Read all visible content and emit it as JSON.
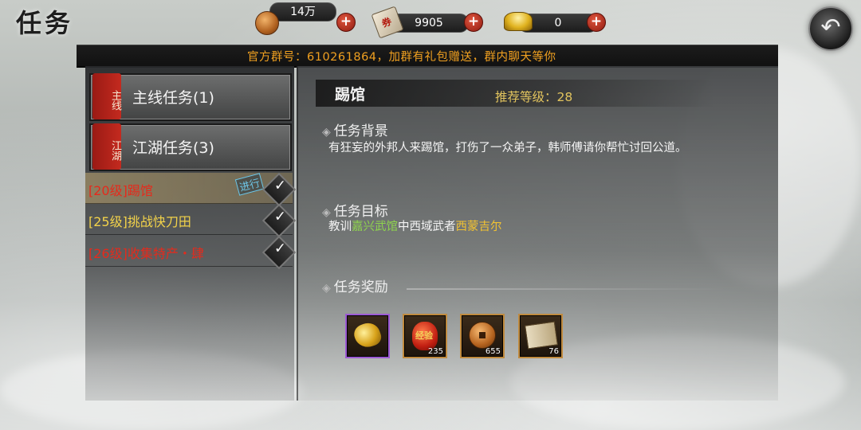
{
  "header": {
    "title": "任务"
  },
  "resources": [
    {
      "icon": "copper-coin-icon",
      "value": "14万"
    },
    {
      "icon": "scroll-ticket-icon",
      "value": "9905"
    },
    {
      "icon": "gold-ingot-icon",
      "value": "0"
    }
  ],
  "notice": {
    "text": "官方群号：610261864，加群有礼包赠送，群内聊天等你"
  },
  "categories": [
    {
      "seal": "主线",
      "label": "主线任务(1)"
    },
    {
      "seal": "江湖",
      "label": "江湖任务(3)"
    }
  ],
  "quests": [
    {
      "text": "[20级]踢馆",
      "color": "#e52a1c",
      "status": "进行",
      "active": true
    },
    {
      "text": "[25级]挑战快刀田",
      "color": "#f2d24a",
      "active": false
    },
    {
      "text": "[26级]收集特产・肆",
      "color": "#e52a1c",
      "active": false
    }
  ],
  "detail": {
    "title": "踢馆",
    "recommend_label": "推荐等级：28",
    "background_heading": "任务背景",
    "background_text": "有狂妄的外邦人来踢馆，打伤了一众弟子，韩师傅请你帮忙讨回公道。",
    "objective_heading": "任务目标",
    "objective_prefix": "教训",
    "objective_place": "嘉兴武馆",
    "objective_mid": "中西域武者",
    "objective_target": "西蒙吉尔",
    "reward_heading": "任务奖励",
    "rewards": [
      {
        "icon": "gold-nugget-icon",
        "qty": "",
        "rarity": "epic"
      },
      {
        "icon": "experience-pill-icon",
        "label": "经验",
        "qty": "235"
      },
      {
        "icon": "copper-coin-icon",
        "qty": "655"
      },
      {
        "icon": "book-scroll-icon",
        "qty": "76"
      }
    ]
  }
}
